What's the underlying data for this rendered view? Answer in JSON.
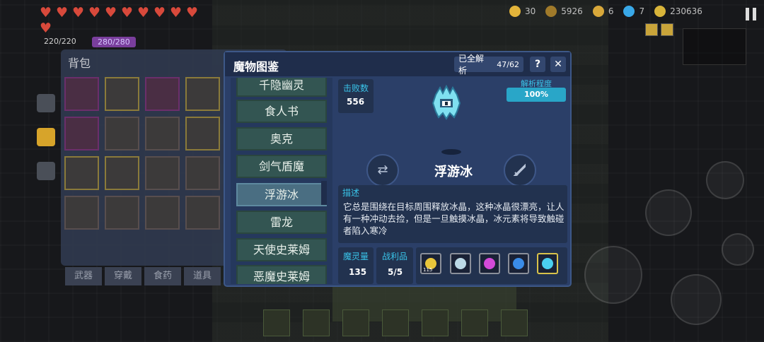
{
  "hud": {
    "hp": "220/220",
    "mp": "280/280",
    "hearts": 11,
    "stats": [
      {
        "name": "crystal-shard",
        "value": "30",
        "color": "#e3b43a"
      },
      {
        "name": "material",
        "value": "5926",
        "color": "#a07a2a"
      },
      {
        "name": "key",
        "value": "6",
        "color": "#d8a83a"
      },
      {
        "name": "gem",
        "value": "7",
        "color": "#39a8e8"
      },
      {
        "name": "coin",
        "value": "230636",
        "color": "#d8b43a"
      }
    ]
  },
  "backpack": {
    "title": "背包",
    "tabs": [
      "武器",
      "穿戴",
      "食药",
      "道具"
    ]
  },
  "modal": {
    "title": "魔物图鉴",
    "progress_label": "已全解析",
    "progress_value": "47/62",
    "help_label": "?",
    "close_label": "✕",
    "monster_list": [
      "千隐幽灵",
      "食人书",
      "奥克",
      "剑气盾魔",
      "浮游冰",
      "雷龙",
      "天使史莱姆",
      "恶魔史莱姆"
    ],
    "selected_index": 4,
    "kills_label": "击败数",
    "kills_value": "556",
    "analysis_label": "解析程度",
    "analysis_value": "100%",
    "analysis_fraction": 1.0,
    "monster_name": "浮游冰",
    "swap_icon": "swap-icon",
    "sword_icon": "sword-icon",
    "desc_label": "描述",
    "description": "它总是围绕在目标周围释放冰晶，这种冰晶很漂亮，让人有一种冲动去捡，但是一旦触摸冰晶，冰元素将导致触碰者陷入寒冷",
    "soul_label": "魔灵量",
    "soul_value": "135",
    "loot_label": "战利品",
    "loot_value": "5/5",
    "loot_items": [
      {
        "icon": "gold-coin-icon",
        "color": "#e8c53a",
        "count": "115",
        "gold_frame": false
      },
      {
        "icon": "magnifier-icon",
        "color": "#bcd9e6",
        "count": "",
        "gold_frame": false
      },
      {
        "icon": "flower-icon",
        "color": "#d44ad8",
        "count": "",
        "gold_frame": false
      },
      {
        "icon": "staff-icon",
        "color": "#3a8ce8",
        "count": "",
        "gold_frame": false
      },
      {
        "icon": "ice-crystal-icon",
        "color": "#4ad0f0",
        "count": "",
        "gold_frame": true
      }
    ]
  }
}
